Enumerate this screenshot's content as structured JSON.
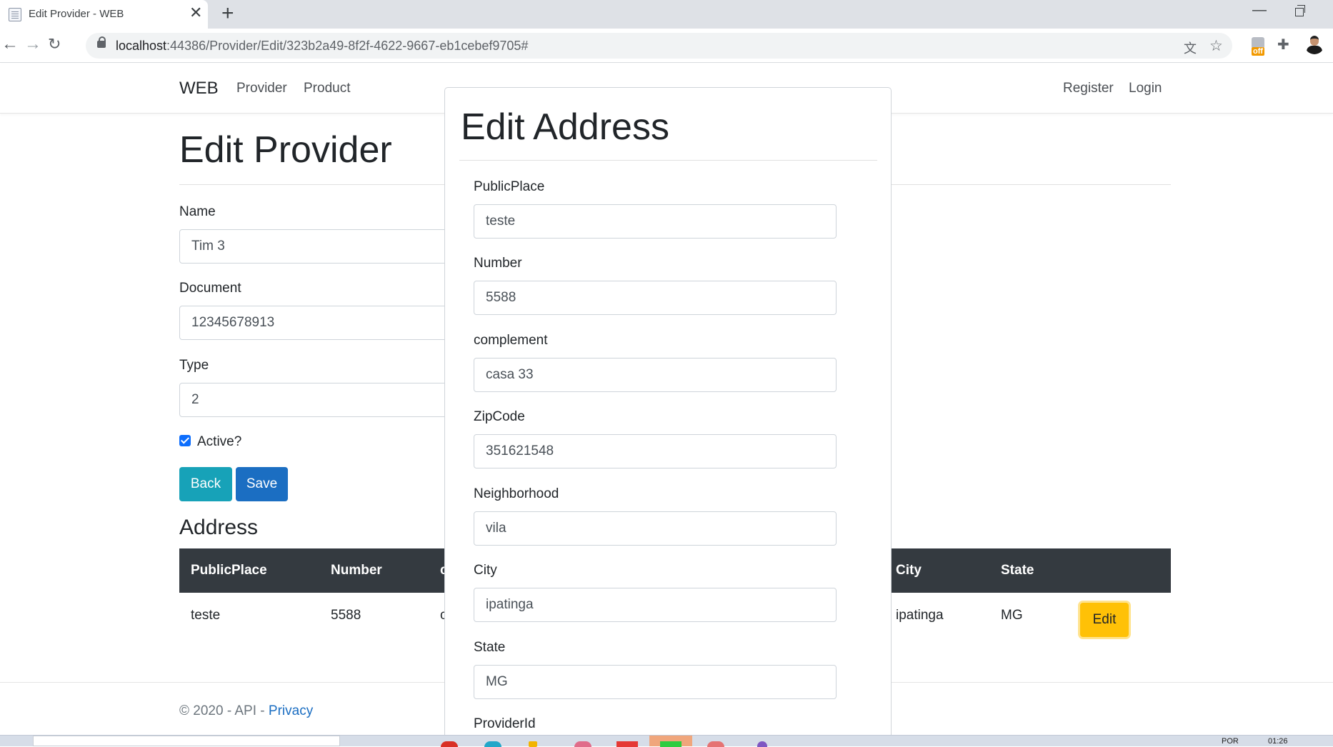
{
  "browser": {
    "tab_title": "Edit Provider - WEB",
    "tab_close": "✕",
    "new_tab": "+",
    "url_host": "localhost",
    "url_path": ":44386/Provider/Edit/323b2a49-8f2f-4622-9667-eb1cebef9705#",
    "icons": [
      "favicon-page-icon",
      "back-icon",
      "forward-icon",
      "reload-icon",
      "lock-icon",
      "translate-icon",
      "star-icon",
      "extension-off-icon",
      "puzzle-icon",
      "profile-avatar"
    ],
    "ext_badge": "off"
  },
  "navbar": {
    "brand": "WEB",
    "links": [
      "Provider",
      "Product"
    ],
    "right_links": [
      "Register",
      "Login"
    ]
  },
  "page": {
    "title": "Edit Provider",
    "fields": {
      "name_label": "Name",
      "name_value": "Tim 3",
      "document_label": "Document",
      "document_value": "12345678913",
      "type_label": "Type",
      "type_value": "2",
      "active_label": "Active?",
      "active_checked": true
    },
    "buttons": {
      "back": "Back",
      "save": "Save"
    },
    "address_title": "Address",
    "table": {
      "headers": [
        "PublicPlace",
        "Number",
        "c",
        "City",
        "State"
      ],
      "row": [
        "teste",
        "5588",
        "c",
        "ipatinga",
        "MG"
      ],
      "edit_button": "Edit"
    }
  },
  "footer": {
    "text": "© 2020 - API - ",
    "link": "Privacy"
  },
  "modal": {
    "title": "Edit Address",
    "fields": [
      {
        "label": "PublicPlace",
        "value": "teste"
      },
      {
        "label": "Number",
        "value": "5588"
      },
      {
        "label": "complement",
        "value": "casa 33"
      },
      {
        "label": "ZipCode",
        "value": "351621548"
      },
      {
        "label": "Neighborhood",
        "value": "vila"
      },
      {
        "label": "City",
        "value": "ipatinga"
      },
      {
        "label": "State",
        "value": "MG"
      }
    ],
    "provider_id_label": "ProviderId"
  },
  "taskbar": {
    "lang": "POR",
    "time": "01:26"
  },
  "colors": {
    "primary": "#1b6ec2",
    "info": "#17a2b8",
    "warning": "#ffc107",
    "table_header": "#343a40"
  }
}
